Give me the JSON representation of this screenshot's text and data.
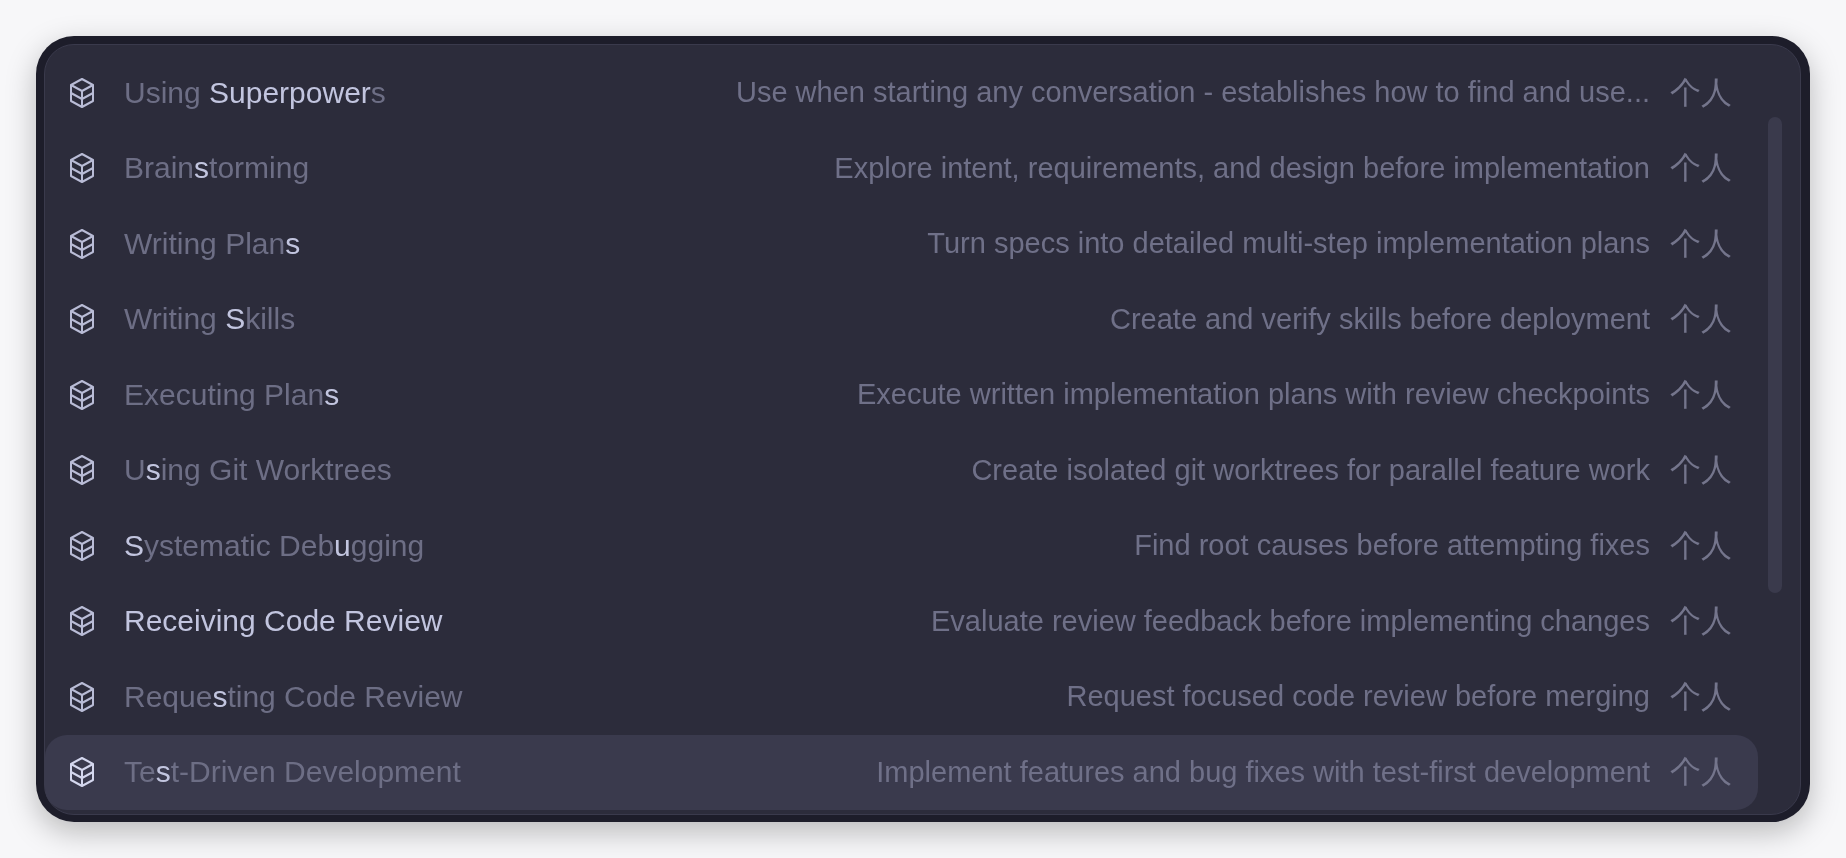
{
  "skills": [
    {
      "name": "Using **Superpower**s",
      "description": "Use when starting any conversation - establishes how to find and use...",
      "tag": "个人",
      "hovered": false,
      "selected": false
    },
    {
      "name": "Brain**s**torming",
      "description": "Explore intent, requirements, and design before implementation",
      "tag": "个人",
      "hovered": false,
      "selected": false
    },
    {
      "name": "Writing Plan**s**",
      "description": "Turn specs into detailed multi-step implementation plans",
      "tag": "个人",
      "hovered": false,
      "selected": false
    },
    {
      "name": "Writing **S**kills",
      "description": "Create and verify skills before deployment",
      "tag": "个人",
      "hovered": false,
      "selected": false
    },
    {
      "name": "Executing Plan**s**",
      "description": "Execute written implementation plans with review checkpoints",
      "tag": "个人",
      "hovered": false,
      "selected": false
    },
    {
      "name": "U**s**ing Git Worktrees",
      "description": "Create isolated git worktrees for parallel feature work",
      "tag": "个人",
      "hovered": false,
      "selected": false
    },
    {
      "name": "**S**ystematic Deb**u**gging",
      "description": "Find root causes before attempting fixes",
      "tag": "个人",
      "hovered": false,
      "selected": false
    },
    {
      "name": "Receiving Code Review",
      "description": "Evaluate review feedback before implementing changes",
      "tag": "个人",
      "hovered": true,
      "selected": false
    },
    {
      "name": "Reque**s**ting Code Review",
      "description": "Request focused code review before merging",
      "tag": "个人",
      "hovered": false,
      "selected": false
    },
    {
      "name": "Te**s**t-Driven Development",
      "description": "Implement features and bug fixes with test-first development",
      "tag": "个人",
      "hovered": false,
      "selected": true
    }
  ]
}
